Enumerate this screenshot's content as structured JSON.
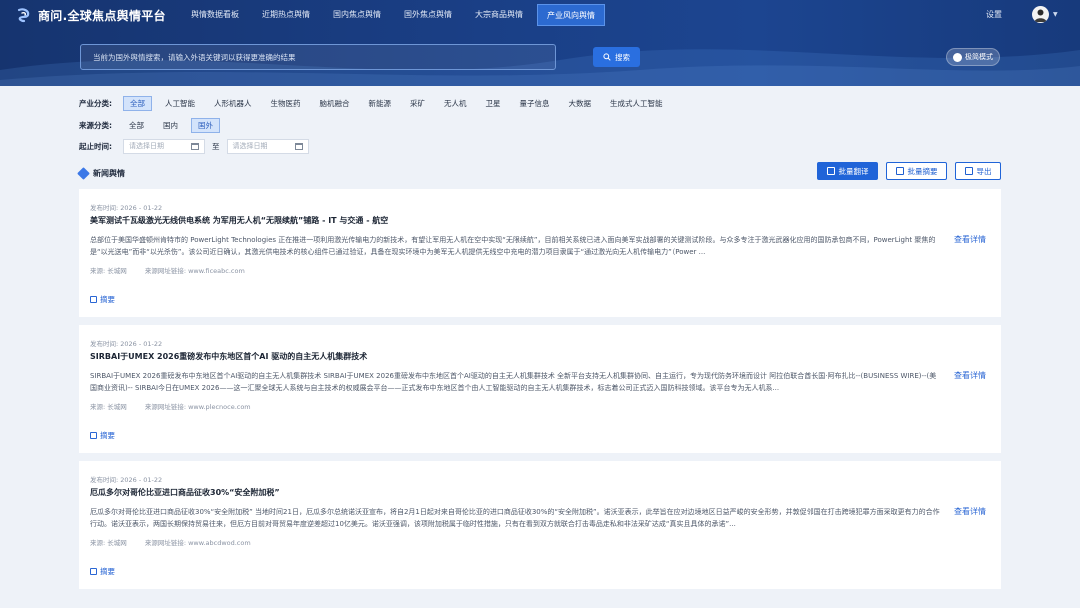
{
  "header": {
    "logo_text": "商问.全球焦点舆情平台",
    "nav": [
      {
        "label": "舆情数据看板",
        "active": false
      },
      {
        "label": "近期热点舆情",
        "active": false
      },
      {
        "label": "国内焦点舆情",
        "active": false
      },
      {
        "label": "国外焦点舆情",
        "active": false
      },
      {
        "label": "大宗商品舆情",
        "active": false
      },
      {
        "label": "产业风向舆情",
        "active": true
      }
    ],
    "settings_label": "设置"
  },
  "search": {
    "placeholder": "当前为国外舆情搜索，请输入外语关键词以获得更准确的结果",
    "button_label": "搜索",
    "mode_label": "极简模式"
  },
  "filters": {
    "industry_label": "产业分类:",
    "industry_options": [
      "全部",
      "人工智能",
      "人形机器人",
      "生物医药",
      "脑机融合",
      "新能源",
      "采矿",
      "无人机",
      "卫星",
      "量子信息",
      "大数据",
      "生成式人工智能"
    ],
    "industry_selected": 0,
    "source_label": "来源分类:",
    "source_options": [
      "全部",
      "国内",
      "国外"
    ],
    "source_selected": 2,
    "time_label": "起止时间:",
    "start_placeholder": "请选择日期",
    "end_placeholder": "请选择日期",
    "separator": "至"
  },
  "section": {
    "title": "新闻舆情",
    "batch_translate": "批量翻译",
    "batch_summary": "批量摘要",
    "export": "导出"
  },
  "articles": [
    {
      "date": "发布时间:  2026 - 01-22",
      "title": "美军测试千瓦级激光无线供电系统 为军用无人机“无限续航”铺路 - IT 与交通 - 航空",
      "body": "总部位于美国华盛顿州肯特市的 PowerLight Technologies 正在推进一项利用激光传输电力的新技术，有望让军用无人机在空中实现“无限续航”，目前相关系统已进入面向美军实战部署的关键测试阶段。与众多专注于激光武器化应用的国防承包商不同，PowerLight 聚焦的是“以光送电”而非“以光杀伤”。该公司近日确认，其激光供电技术的核心组件已通过验证，具备在现实环境中为美军无人机提供无线空中充电的潜力项目隶属于“通过激光向无人机传输电力”（Power ...",
      "source": "来源:  长城网",
      "link": "来源网址链接:  www.ficeabc.com",
      "detail": "查看详情",
      "summary": "摘要"
    },
    {
      "date": "发布时间:  2026 - 01-22",
      "title": "SIRBAI于UMEX 2026重磅发布中东地区首个AI 驱动的自主无人机集群技术",
      "body": "SIRBAI于UMEX 2026重磅发布中东地区首个AI驱动的自主无人机集群技术 SIRBAI于UMEX 2026重磅发布中东地区首个AI驱动的自主无人机集群技术 全新平台支持无人机集群协同、自主运行，专为现代防务环境而设计 阿拉伯联合酋长国·阿布扎比--(BUSINESS WIRE)--(美国商业资讯)-- SIRBAI今日在UMEX 2026——这一汇聚全球无人系统与自主技术的权威展会平台——正式发布中东地区首个由人工智能驱动的自主无人机集群技术，标志着公司正式迈入国防科技领域。该平台专为无人机系...",
      "source": "来源:  长城网",
      "link": "来源网址链接:  www.plecnoce.com",
      "detail": "查看详情",
      "summary": "摘要"
    },
    {
      "date": "发布时间:  2026 - 01-22",
      "title": "厄瓜多尔对哥伦比亚进口商品征收30%“安全附加税”",
      "body": "厄瓜多尔对哥伦比亚进口商品征收30%“安全附加税” 当地时间21日，厄瓜多尔总统诺沃亚宣布，将自2月1日起对来自哥伦比亚的进口商品征收30%的“安全附加税”。诺沃亚表示，此举旨在应对边境地区日益严峻的安全形势，并敦促邻国在打击跨境犯罪方面采取更有力的合作行动。诺沃亚表示，两国长期保持贸易往来，但厄方目前对哥贸易年度逆差超过10亿美元。诺沃亚强调，该项附加税属于临时性措施，只有在看到双方就联合打击毒品走私和非法采矿达成“真实且具体的承诺”...",
      "source": "来源:  长城网",
      "link": "来源网址链接:  www.abcdwod.com",
      "detail": "查看详情",
      "summary": "摘要"
    }
  ]
}
